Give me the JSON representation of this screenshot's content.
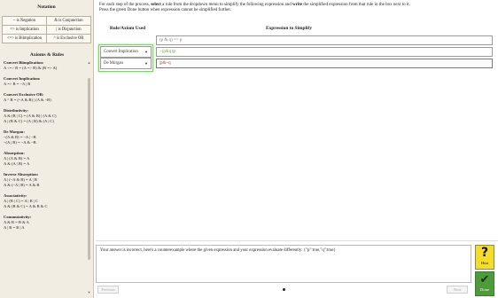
{
  "sidebar": {
    "notation_title": "Notation",
    "notation": [
      [
        "~ is Negation",
        "& is Conjunction"
      ],
      [
        "=> is Implication",
        "| is Disjunction"
      ],
      [
        "<=> is Biimplication",
        "^ is Exclusive OR"
      ]
    ],
    "axioms_title": "Axioms & Rules",
    "axioms": [
      {
        "name": "Convert Biimplication:",
        "lines": [
          "A <=> B = (A => B) & (B => A)"
        ]
      },
      {
        "name": "Convert Implication:",
        "lines": [
          "A => B = ~A | B"
        ]
      },
      {
        "name": "Convert Exclusive OR:",
        "lines": [
          "A ^ B = (~A & B) | (A & ~B)"
        ]
      },
      {
        "name": "Distributivity:",
        "lines": [
          "A & (B | C) = (A & B) | (A & C)",
          "A | (B & C) = (A | B) & (A | C)"
        ]
      },
      {
        "name": "De Morgan:",
        "lines": [
          "~(A & B) = ~A | ~B",
          "~(A | B) = ~A & ~B"
        ]
      },
      {
        "name": "Absorption:",
        "lines": [
          "A | (A & B) = A",
          "A & (A | B) = A"
        ]
      },
      {
        "name": "Inverse Absorption:",
        "lines": [
          "A | (~A & B) = A | B",
          "A & (~A | B) = A & B"
        ]
      },
      {
        "name": "Associativity:",
        "lines": [
          "A | (B | C) = A | B | C",
          "A & (B & C) = A & B & C"
        ]
      },
      {
        "name": "Commutativity:",
        "lines": [
          "A & B = B & A",
          "A | B = B | A"
        ]
      }
    ]
  },
  "instructions": {
    "line1_pre": "For each step of the process, ",
    "line1_b1": "select",
    "line1_mid": " a rule from the dropdown menu to simplify the following expression and ",
    "line1_b2": "write",
    "line1_post": " the simplified expression from that rule in the box next to it.",
    "line2": "Press the green Done button when expression cannot be simplified further."
  },
  "headers": {
    "rule": "Rule/Axiom Used",
    "expression": "Expression to Simplify"
  },
  "given_expression": "(p & q) => p",
  "steps": [
    {
      "rule": "Convert Implication",
      "expression": "~(p&q)|p",
      "status_color": "#5aaa48"
    },
    {
      "rule": "De Morgan",
      "expression": "|p&~q",
      "status_color": "#c0392b"
    }
  ],
  "feedback": "Your answer is incorrect, here's a counterexample where the given expression and your expression evaluate differently: {\"p\":true,\"q\":true}",
  "nav": {
    "previous": "Previous",
    "next": "Next"
  },
  "buttons": {
    "hint": "Hint",
    "done": "Done"
  }
}
